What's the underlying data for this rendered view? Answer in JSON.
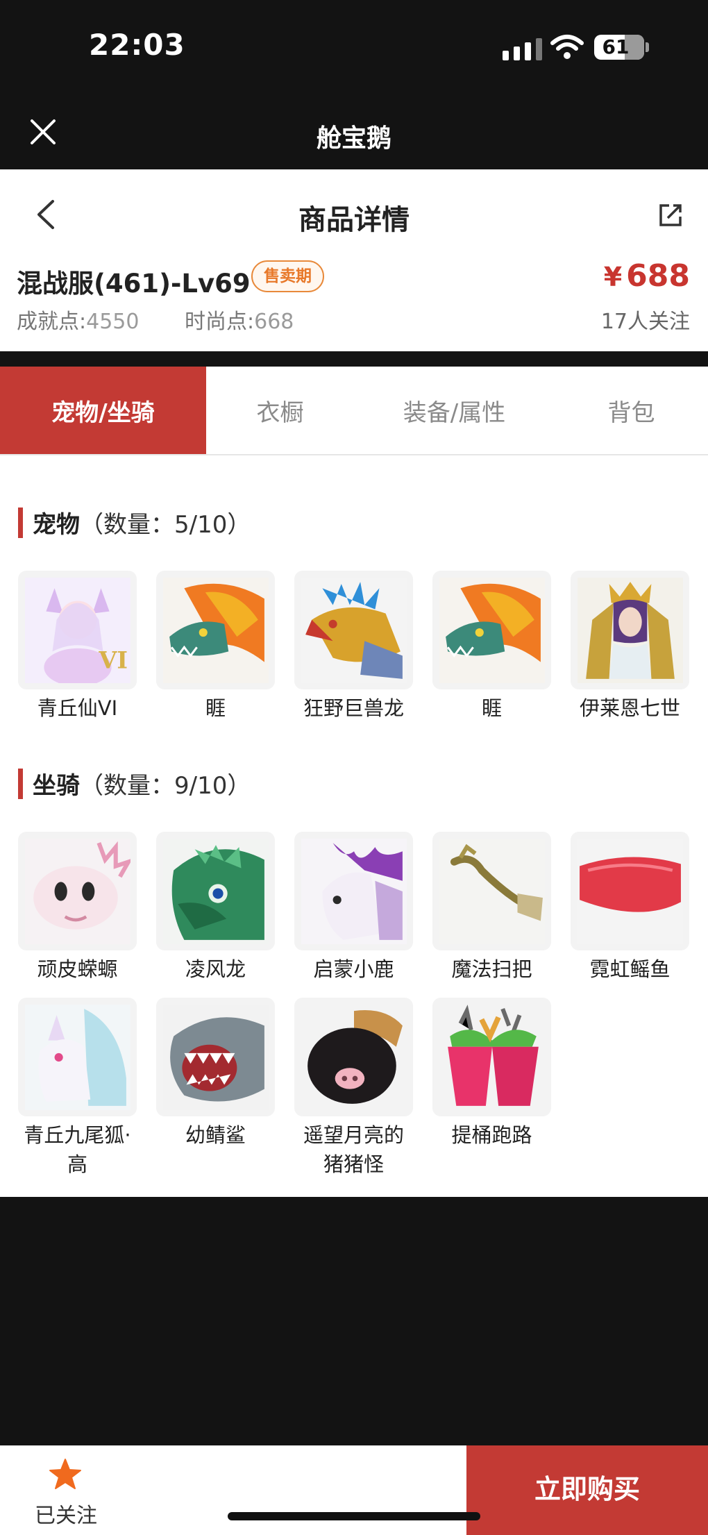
{
  "status": {
    "time": "22:03",
    "battery": "61",
    "battery_level": 0.61
  },
  "appbar": {
    "title": "舱宝鹅"
  },
  "header": {
    "page_title": "商品详情",
    "product_name": "混战服(461)-Lv69",
    "badge": "售卖期",
    "price_currency": "¥",
    "price": "688",
    "achievement_label": "成就点:",
    "achievement_value": "4550",
    "fashion_label": "时尚点:",
    "fashion_value": "668",
    "followers": "17人关注"
  },
  "tabs": [
    {
      "label": "宠物/坐骑",
      "active": true
    },
    {
      "label": "衣橱",
      "active": false
    },
    {
      "label": "装备/属性",
      "active": false
    },
    {
      "label": "背包",
      "active": false
    }
  ],
  "pets": {
    "title": "宠物",
    "count": "（数量：5/10）",
    "items": [
      {
        "name": "青丘仙VI",
        "icon": "fox-fairy-icon"
      },
      {
        "name": "睚",
        "icon": "fire-dragon-icon"
      },
      {
        "name": "狂野巨兽龙",
        "icon": "wild-dragon-icon"
      },
      {
        "name": "睚",
        "icon": "fire-dragon-icon"
      },
      {
        "name": "伊莱恩七世",
        "icon": "queen-icon"
      }
    ]
  },
  "mounts": {
    "title": "坐骑",
    "count": "（数量：9/10）",
    "items": [
      {
        "name": "顽皮蝾螈",
        "icon": "axolotl-icon"
      },
      {
        "name": "凌风龙",
        "icon": "green-dragon-icon"
      },
      {
        "name": "启蒙小鹿",
        "icon": "deer-icon"
      },
      {
        "name": "魔法扫把",
        "icon": "broom-icon"
      },
      {
        "name": "霓虹鳐鱼",
        "icon": "ray-icon"
      },
      {
        "name": "青丘九尾狐·高",
        "icon": "nine-tail-fox-icon"
      },
      {
        "name": "幼鲭鲨",
        "icon": "shark-icon"
      },
      {
        "name": "遥望月亮的猪猪怪",
        "icon": "pig-icon"
      },
      {
        "name": "提桶跑路",
        "icon": "bucket-icon"
      }
    ]
  },
  "bottom": {
    "follow_label": "已关注",
    "buy_label": "立即购买"
  },
  "colors": {
    "accent": "#c33a34",
    "badge": "#e8792a",
    "star": "#f06a1e"
  }
}
